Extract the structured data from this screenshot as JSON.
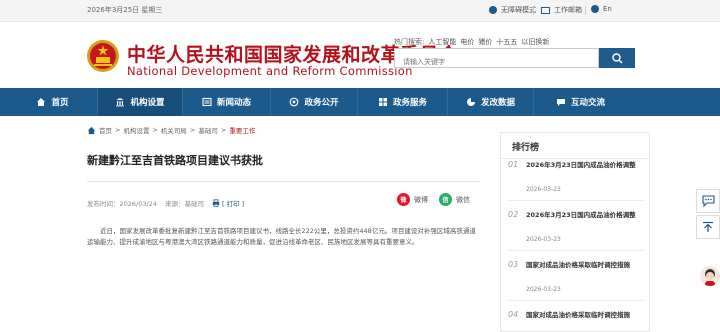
{
  "topbar": {
    "date": "2026年3月25日 星期三",
    "accessible_mode": "无障碍模式",
    "work_mail": "工作邮箱",
    "english": "En"
  },
  "header": {
    "title_cn": "中华人民共和国国家发展和改革委员会",
    "title_en": "National Development and Reform Commission",
    "hot_label": "热门搜索:",
    "hot_words": [
      "人工智能",
      "电价",
      "猪价",
      "十五五",
      "以旧换新"
    ],
    "search_placeholder": "请输入关键字"
  },
  "nav": {
    "items": [
      {
        "label": "首页",
        "icon": "home-icon"
      },
      {
        "label": "机构设置",
        "icon": "building-icon"
      },
      {
        "label": "新闻动态",
        "icon": "news-icon"
      },
      {
        "label": "政务公开",
        "icon": "open-icon"
      },
      {
        "label": "政务服务",
        "icon": "service-icon"
      },
      {
        "label": "发改数据",
        "icon": "chart-icon"
      },
      {
        "label": "互动交流",
        "icon": "chat-icon"
      }
    ]
  },
  "breadcrumb": {
    "items": [
      "首页",
      "机构设置",
      "机关司局",
      "基础司"
    ],
    "current": "重要工作",
    "sep": ">"
  },
  "article": {
    "title": "新建黔江至吉首铁路项目建议书获批",
    "published_label": "发布时间：",
    "published": "2026/03/24",
    "source_label": "来源：",
    "source": "基础司",
    "print": "[ 打印 ]",
    "share_weibo": "微博",
    "share_wechat": "微信",
    "body": "近日，国家发展改革委批复新建黔江至吉首铁路项目建议书，线路全长222公里，总投资约448亿元。项目建设对补强区域高铁通道运输能力、提升成渝地区与粤港澳大湾区铁路通道能力和质量，促进沿线革命老区、民族地区发展等具有重要意义。"
  },
  "ranking": {
    "title": "排行榜",
    "items": [
      {
        "num": "01",
        "title": "2026年3月23日国内成品油价格调整",
        "date": "2026-03-23"
      },
      {
        "num": "02",
        "title": "2026年3月23日国内成品油价格调整",
        "date": "2026-03-23"
      },
      {
        "num": "03",
        "title": "国家对成品油价格采取临时调控措施",
        "date": "2026-03-23"
      },
      {
        "num": "04",
        "title": "国家对成品油价格采取临时调控措施",
        "date": ""
      }
    ]
  },
  "colors": {
    "brand_red": "#b3121a",
    "nav_blue": "#1b5a8a"
  }
}
